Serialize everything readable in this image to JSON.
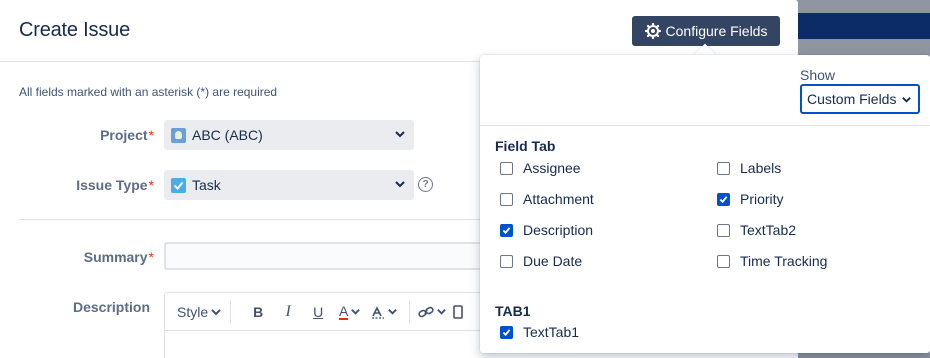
{
  "dialog": {
    "title": "Create Issue",
    "configure_button": "Configure Fields",
    "required_note": "All fields marked with an asterisk (*) are required"
  },
  "fields": {
    "project": {
      "label": "Project",
      "value": "ABC (ABC)"
    },
    "issue_type": {
      "label": "Issue Type",
      "value": "Task"
    },
    "summary": {
      "label": "Summary",
      "value": ""
    },
    "description": {
      "label": "Description"
    }
  },
  "editor_toolbar": {
    "style_label": "Style",
    "bold": "B",
    "italic": "I",
    "underline": "U",
    "text_color": "A"
  },
  "popover": {
    "show_label": "Show",
    "show_value": "Custom Fields",
    "groups": [
      {
        "title": "Field Tab",
        "items": [
          {
            "label": "Assignee",
            "checked": false
          },
          {
            "label": "Labels",
            "checked": false
          },
          {
            "label": "Attachment",
            "checked": false
          },
          {
            "label": "Priority",
            "checked": true
          },
          {
            "label": "Description",
            "checked": true
          },
          {
            "label": "TextTab2",
            "checked": false
          },
          {
            "label": "Due Date",
            "checked": false
          },
          {
            "label": "Time Tracking",
            "checked": false
          }
        ]
      },
      {
        "title": "TAB1",
        "items": [
          {
            "label": "TextTab1",
            "checked": true
          }
        ]
      }
    ]
  },
  "colors": {
    "primary": "#0052cc",
    "button_dark": "#344563",
    "required_star": "#de350b",
    "header_navy": "#0b2c67"
  }
}
